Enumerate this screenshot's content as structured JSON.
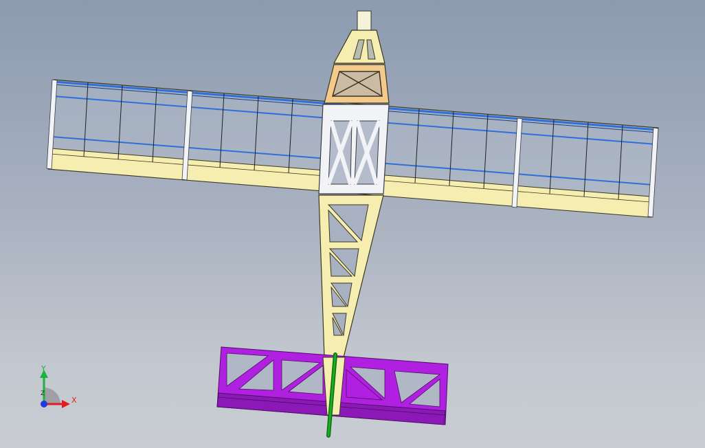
{
  "viewport": {
    "background_top": "#8c9bb0",
    "background_bottom": "#c9cdd3"
  },
  "model": {
    "colors": {
      "balsa": "#f5eeb0",
      "balsa_edge": "#3a3620",
      "nose_block": "#f3c98c",
      "spar": "#2e6fd8",
      "rib_white": "#f2f3f7",
      "tail": "#b020e0",
      "tail_dark": "#8d18b8",
      "rudder_rod": "#18b020",
      "motor_mount": "#f4f2d8"
    }
  },
  "triad": {
    "x_label": "X",
    "y_label": "Y",
    "z_label": "Z",
    "x_color": "#e21d1d",
    "y_color": "#19b53a",
    "z_color": "#1d3ae2"
  }
}
